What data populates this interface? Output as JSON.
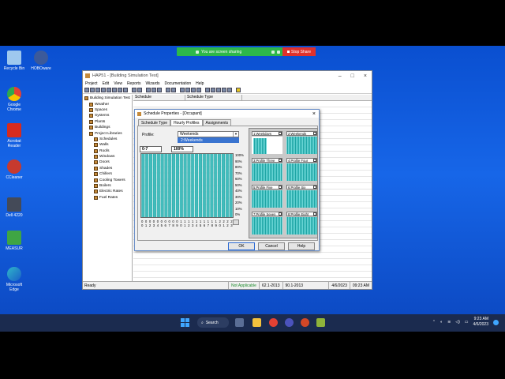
{
  "sharebar": {
    "message": "You are screen sharing",
    "stop_label": "Stop Share"
  },
  "desktop_icons": [
    {
      "label": "Recycle Bin",
      "color": "#9ec8ee"
    },
    {
      "label": "HOBOware",
      "color": "#3c5a9a"
    },
    {
      "label": "Google Chrome",
      "color": "#e34133"
    },
    {
      "label": "Acrobat Reader",
      "color": "#d62b1f"
    },
    {
      "label": "CCleaner",
      "color": "#c73a2e"
    },
    {
      "label": "Dell 4220",
      "color": "#444a58"
    },
    {
      "label": "MEASUR",
      "color": "#3fa544"
    },
    {
      "label": "Microsoft Edge",
      "color": "#2fb6c9"
    }
  ],
  "hap": {
    "title": "HAP51 - [Building Simulation Test]",
    "menu": [
      "Project",
      "Edit",
      "View",
      "Reports",
      "Wizards",
      "Documentation",
      "Help"
    ],
    "tree": [
      {
        "label": "Building Simulation Test",
        "level": 0
      },
      {
        "label": "Weather",
        "level": 1
      },
      {
        "label": "Spaces",
        "level": 1
      },
      {
        "label": "Systems",
        "level": 1
      },
      {
        "label": "Plants",
        "level": 1
      },
      {
        "label": "Buildings",
        "level": 1
      },
      {
        "label": "Project Libraries",
        "level": 1
      },
      {
        "label": "Schedules",
        "level": 2
      },
      {
        "label": "Walls",
        "level": 2
      },
      {
        "label": "Roofs",
        "level": 2
      },
      {
        "label": "Windows",
        "level": 2
      },
      {
        "label": "Doors",
        "level": 2
      },
      {
        "label": "Shades",
        "level": 2
      },
      {
        "label": "Chillers",
        "level": 2
      },
      {
        "label": "Cooling Towers",
        "level": 2
      },
      {
        "label": "Boilers",
        "level": 2
      },
      {
        "label": "Electric Rates",
        "level": 2
      },
      {
        "label": "Fuel Rates",
        "level": 2
      }
    ],
    "columns": [
      "Schedule",
      "Schedule Type"
    ],
    "status": {
      "ready": "Ready",
      "na": "Not Applicable",
      "s1": "62.1-2013",
      "s2": "90.1-2013",
      "date": "4/6/2023",
      "time": "09:23 AM"
    }
  },
  "dialog": {
    "title": "Schedule Properties - [Occupant]",
    "tabs": [
      "Schedule Type",
      "Hourly Profiles",
      "Assignments"
    ],
    "profile_label": "Profile:",
    "profile_value": "Weekends",
    "dropdown_item": "2:Weekends",
    "hour_range": "0-7",
    "percent": "100%",
    "y_ticks": [
      "100%",
      "90%",
      "80%",
      "70%",
      "60%",
      "50%",
      "40%",
      "30%",
      "20%",
      "10%",
      "0%"
    ],
    "hours_tens": [
      "0",
      "0",
      "0",
      "0",
      "0",
      "0",
      "0",
      "0",
      "0",
      "0",
      "1",
      "1",
      "1",
      "1",
      "1",
      "1",
      "1",
      "1",
      "1",
      "1",
      "2",
      "2",
      "2",
      "2"
    ],
    "hours_ones": [
      "0",
      "1",
      "2",
      "3",
      "4",
      "5",
      "6",
      "7",
      "8",
      "9",
      "0",
      "1",
      "2",
      "3",
      "4",
      "5",
      "6",
      "7",
      "8",
      "9",
      "0",
      "1",
      "2",
      "3"
    ],
    "hourly_values": [
      100,
      100,
      100,
      100,
      100,
      100,
      100,
      100,
      100,
      100,
      100,
      100,
      100,
      100,
      100,
      100,
      100,
      100,
      100,
      100,
      100,
      100,
      100,
      100
    ],
    "profile_cards": [
      "1:Weekdays",
      "2:Weekends",
      "3:Profile Three",
      "4:Profile Four",
      "5:Profile Five",
      "6:Profile Six",
      "7:Profile Seven",
      "8:Profile Eight"
    ],
    "ok": "OK",
    "cancel": "Cancel",
    "help": "Help",
    "bar_color": "#1ea5a5"
  },
  "taskbar": {
    "search": "Search",
    "time": "9:23 AM",
    "date": "4/6/2023"
  }
}
